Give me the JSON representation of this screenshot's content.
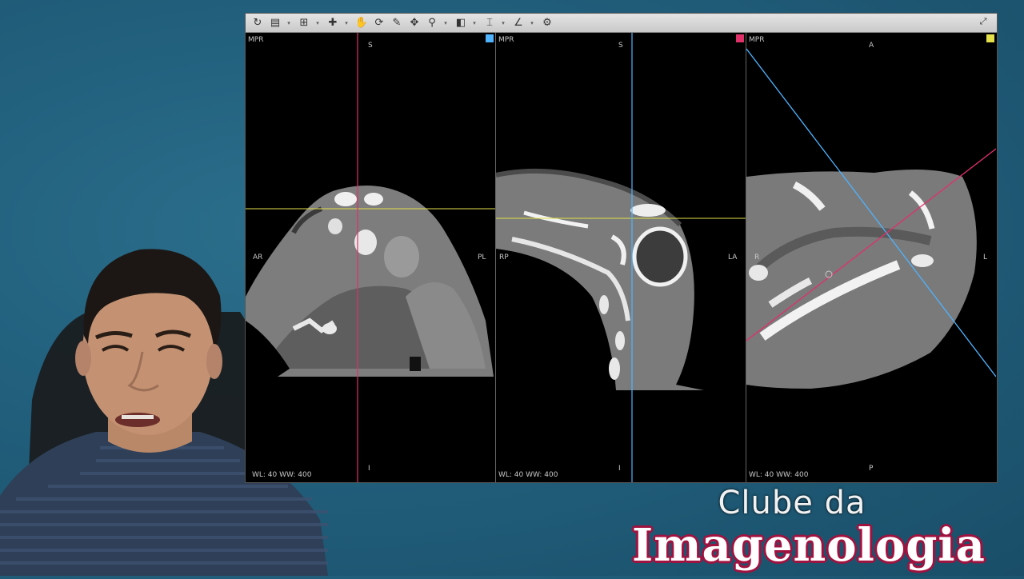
{
  "viewer": {
    "toolbar": {
      "icons": [
        "refresh-icon",
        "save-icon",
        "layout-grid-icon",
        "crosshair-icon",
        "pan-icon",
        "rotate-icon",
        "zoom-icon",
        "window-level-icon",
        "measure-icon",
        "annotate-icon",
        "settings-icon"
      ],
      "maximize_icon": "maximize-icon"
    },
    "panes": [
      {
        "name": "pane-coronal",
        "mode_label": "MPR",
        "top_label": "S",
        "bottom_label": "I",
        "left_label": "AR",
        "right_label": "PL",
        "window_label": "WL: 40 WW: 400",
        "marker_color": "#4fb3ff",
        "crosshair_vertical_color": "#e0306a",
        "crosshair_horizontal_color": "#e4e04a"
      },
      {
        "name": "pane-sagittal",
        "mode_label": "MPR",
        "top_label": "S",
        "bottom_label": "I",
        "left_label": "RP",
        "right_label": "LA",
        "window_label": "WL: 40 WW: 400",
        "marker_color": "#e0306a",
        "crosshair_vertical_color": "#4fb3ff",
        "crosshair_horizontal_color": "#e4e04a"
      },
      {
        "name": "pane-axial",
        "mode_label": "MPR",
        "top_label": "A",
        "bottom_label": "P",
        "left_label": "R",
        "right_label": "L",
        "window_label": "WL: 40 WW: 400",
        "marker_color": "#e4e04a",
        "crosshair_line1_color": "#4fb3ff",
        "crosshair_line2_color": "#e0306a"
      }
    ]
  },
  "brand": {
    "line1": "Clube da",
    "line2": "Imagenologia",
    "outline_color": "#a0123f"
  }
}
